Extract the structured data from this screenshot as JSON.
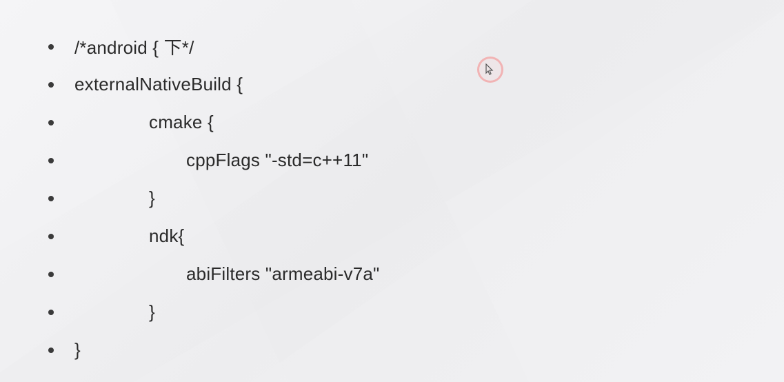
{
  "slide": {
    "lines": [
      {
        "indent": 0,
        "text": "/*android { 下*/"
      },
      {
        "indent": 0,
        "text": "externalNativeBuild {"
      },
      {
        "indent": 1,
        "text": "cmake {"
      },
      {
        "indent": 2,
        "text": "cppFlags \"-std=c++11\""
      },
      {
        "indent": 1,
        "text": "}"
      },
      {
        "indent": 1,
        "text": "ndk{"
      },
      {
        "indent": 2,
        "text": "abiFilters \"armeabi-v7a\""
      },
      {
        "indent": 1,
        "text": "}"
      },
      {
        "indent": 0,
        "text": "}"
      }
    ]
  },
  "cursor": {
    "glyph": "↖"
  }
}
